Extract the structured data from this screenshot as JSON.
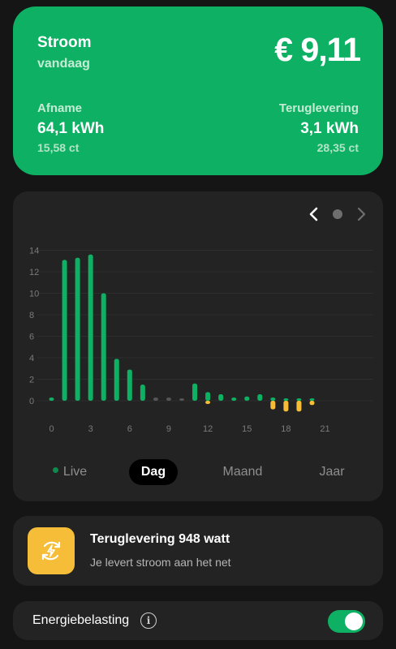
{
  "summary": {
    "title": "Stroom",
    "subtitle": "vandaag",
    "total": "€ 9,11",
    "afname": {
      "label": "Afname",
      "value": "64,1 kWh",
      "price": "15,58 ct"
    },
    "teruglevering": {
      "label": "Teruglevering",
      "value": "3,1 kWh",
      "price": "28,35 ct"
    }
  },
  "chart_nav": {
    "prev_icon": "chevron-left-icon",
    "next_icon": "chevron-right-icon"
  },
  "chart_data": {
    "type": "bar",
    "ylim": [
      0,
      14
    ],
    "yticks": [
      0,
      2,
      4,
      6,
      8,
      10,
      12,
      14
    ],
    "xticks": [
      0,
      3,
      6,
      9,
      12,
      15,
      18,
      21
    ],
    "hours": [
      0,
      1,
      2,
      3,
      4,
      5,
      6,
      7,
      8,
      9,
      10,
      11,
      12,
      13,
      14,
      15,
      16,
      17,
      18,
      19,
      20,
      21,
      22,
      23
    ],
    "series": [
      {
        "name": "Afname",
        "color": "#0eb163",
        "values": [
          0.3,
          13.1,
          13.3,
          13.6,
          10.0,
          3.9,
          2.9,
          1.5,
          0.3,
          0.3,
          0.2,
          1.6,
          0.8,
          0.6,
          0.3,
          0.4,
          0.6,
          0.3,
          0.2,
          0.1,
          0.2,
          0.0,
          0.0,
          0.0
        ]
      },
      {
        "name": "Teruglevering",
        "color": "#f6bd38",
        "values": [
          0,
          0,
          0,
          0,
          0,
          0,
          0,
          0,
          0,
          0,
          0,
          0,
          -0.3,
          0,
          0,
          0,
          0,
          -0.8,
          -1.0,
          -1.0,
          -0.4,
          0,
          0,
          0
        ]
      }
    ],
    "muted_hours": [
      8,
      9,
      10
    ],
    "muted_color": "#555555",
    "grid": true
  },
  "tabs": [
    {
      "label": "Live"
    },
    {
      "label": "Dag"
    },
    {
      "label": "Maand"
    },
    {
      "label": "Jaar"
    }
  ],
  "feed": {
    "icon": "solar-power-icon",
    "title": "Teruglevering 948 watt",
    "description": "Je levert stroom aan het net"
  },
  "tax": {
    "label": "Energiebelasting",
    "info_icon": "info-icon",
    "enabled": true
  },
  "colors": {
    "brand_green": "#0eb163",
    "feed_yellow": "#f6bd38",
    "card_bg": "#232323",
    "page_bg": "#151515"
  }
}
